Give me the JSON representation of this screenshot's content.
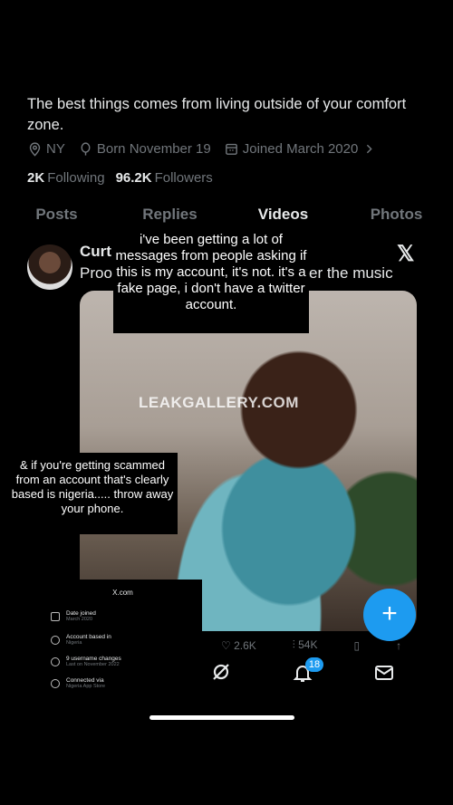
{
  "profile": {
    "bio": "The best things comes from living outside of your comfort zone.",
    "location": "NY",
    "born": "Born November 19",
    "joined": "Joined March 2020",
    "following_count": "2K",
    "following_label": "Following",
    "followers_count": "96.2K",
    "followers_label": "Followers"
  },
  "tabs": [
    "Posts",
    "Replies",
    "Videos",
    "Photos"
  ],
  "post": {
    "name": "Curt",
    "text_start": "Proo",
    "text_end": "er the music",
    "watermark": "LEAKGALLERY.COM",
    "likes": "2.6K",
    "views": "54K"
  },
  "captions": {
    "top": "i've been getting a lot of messages from people asking if this is my account, it's not. it's a fake page, i don't have a twitter account.",
    "middle": "& if you're getting scammed from an account that's clearly based is nigeria..... throw away your phone."
  },
  "about_panel": {
    "title": "X.com",
    "rows": [
      {
        "label": "Date joined",
        "value": "March 2020"
      },
      {
        "label": "Account based in",
        "value": "Nigeria"
      },
      {
        "label": "9 username changes",
        "value": "Last on November 2022"
      },
      {
        "label": "Connected via",
        "value": "Nigeria App Store"
      }
    ]
  },
  "nav": {
    "notifications_badge": "18"
  },
  "colors": {
    "accent": "#1d9bf0",
    "muted": "#71767b",
    "text": "#e7e9ea"
  }
}
